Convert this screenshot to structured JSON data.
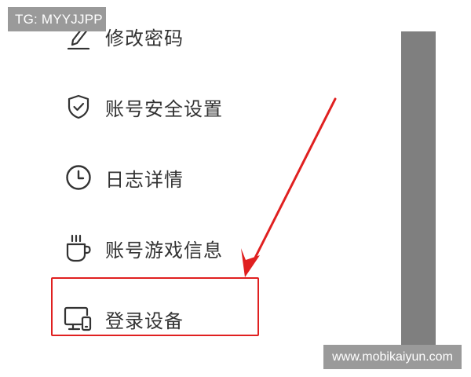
{
  "watermarks": {
    "top_left": "TG: MYYJJPP",
    "bottom_right": "www.mobikaiyun.com"
  },
  "menu": {
    "items": [
      {
        "label": "修改密码",
        "icon": "pencil-icon"
      },
      {
        "label": "账号安全设置",
        "icon": "shield-check-icon"
      },
      {
        "label": "日志详情",
        "icon": "clock-icon"
      },
      {
        "label": "账号游戏信息",
        "icon": "steaming-cup-icon"
      },
      {
        "label": "登录设备",
        "icon": "devices-icon"
      }
    ]
  },
  "annotation": {
    "highlight_color": "#e02020",
    "highlighted_item": "登录设备"
  },
  "colors": {
    "text": "#333333",
    "icon": "#333333",
    "side_panel": "#7f7f7f",
    "watermark_bg": "#9a9a9a"
  }
}
